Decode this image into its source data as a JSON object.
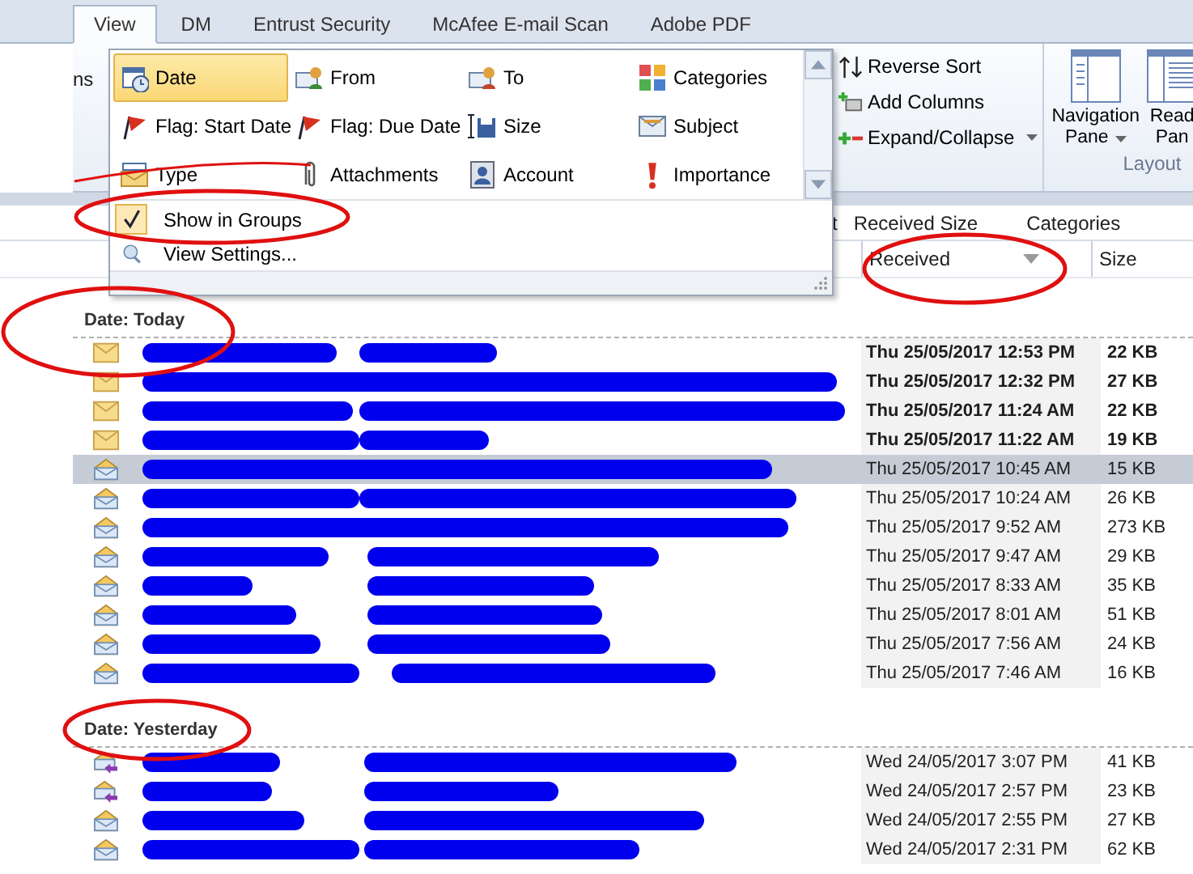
{
  "tabs": [
    {
      "label": "View",
      "selected": true
    },
    {
      "label": "DM",
      "selected": false
    },
    {
      "label": "Entrust Security",
      "selected": false
    },
    {
      "label": "McAfee E-mail Scan",
      "selected": false
    },
    {
      "label": "Adobe PDF",
      "selected": false
    }
  ],
  "ribbon": {
    "left_fragment": "ns",
    "sort_buttons": [
      {
        "label": "Reverse Sort",
        "dropdown": false
      },
      {
        "label": "Add Columns",
        "dropdown": false
      },
      {
        "label": "Expand/Collapse",
        "dropdown": true
      }
    ],
    "layout_buttons": [
      {
        "lines": [
          "Navigation",
          "Pane"
        ],
        "dropdown": true
      },
      {
        "lines": [
          "Read",
          "Pan"
        ],
        "dropdown": false
      }
    ],
    "layout_group_label": "Layout"
  },
  "arrange_menu": {
    "items": [
      {
        "label": "Date",
        "selected": true
      },
      {
        "label": "From",
        "selected": false
      },
      {
        "label": "To",
        "selected": false
      },
      {
        "label": "Categories",
        "selected": false
      },
      {
        "label": "Flag: Start Date",
        "selected": false
      },
      {
        "label": "Flag: Due Date",
        "selected": false
      },
      {
        "label": "Size",
        "selected": false
      },
      {
        "label": "Subject",
        "selected": false
      },
      {
        "label": "Type",
        "selected": false
      },
      {
        "label": "Attachments",
        "selected": false
      },
      {
        "label": "Account",
        "selected": false
      },
      {
        "label": "Importance",
        "selected": false
      }
    ],
    "options": [
      {
        "label": "Show in Groups",
        "checked": true
      },
      {
        "label": "View Settings...",
        "checked": false
      }
    ]
  },
  "column_tray": {
    "fragment": "t",
    "fields": [
      "Received Size",
      "Categories"
    ]
  },
  "columns": [
    {
      "label": "Received",
      "sorted": true
    },
    {
      "label": "Size",
      "sorted": false
    }
  ],
  "groups": [
    {
      "label": "Date: Today",
      "rows": [
        {
          "kind": "unread",
          "unread": true,
          "selected": false,
          "received": "Thu 25/05/2017 12:53 PM",
          "size": "22 KB"
        },
        {
          "kind": "unread",
          "unread": true,
          "selected": false,
          "received": "Thu 25/05/2017 12:32 PM",
          "size": "27 KB"
        },
        {
          "kind": "unread",
          "unread": true,
          "selected": false,
          "received": "Thu 25/05/2017 11:24 AM",
          "size": "22 KB"
        },
        {
          "kind": "unread",
          "unread": true,
          "selected": false,
          "received": "Thu 25/05/2017 11:22 AM",
          "size": "19 KB"
        },
        {
          "kind": "read",
          "unread": false,
          "selected": true,
          "received": "Thu 25/05/2017 10:45 AM",
          "size": "15 KB"
        },
        {
          "kind": "read",
          "unread": false,
          "selected": false,
          "received": "Thu 25/05/2017 10:24 AM",
          "size": "26 KB"
        },
        {
          "kind": "read",
          "unread": false,
          "selected": false,
          "received": "Thu 25/05/2017 9:52 AM",
          "size": "273 KB"
        },
        {
          "kind": "read",
          "unread": false,
          "selected": false,
          "received": "Thu 25/05/2017 9:47 AM",
          "size": "29 KB"
        },
        {
          "kind": "read",
          "unread": false,
          "selected": false,
          "received": "Thu 25/05/2017 8:33 AM",
          "size": "35 KB"
        },
        {
          "kind": "read",
          "unread": false,
          "selected": false,
          "received": "Thu 25/05/2017 8:01 AM",
          "size": "51 KB"
        },
        {
          "kind": "read",
          "unread": false,
          "selected": false,
          "received": "Thu 25/05/2017 7:56 AM",
          "size": "24 KB"
        },
        {
          "kind": "read",
          "unread": false,
          "selected": false,
          "received": "Thu 25/05/2017 7:46 AM",
          "size": "16 KB"
        }
      ]
    },
    {
      "label": "Date: Yesterday",
      "rows": [
        {
          "kind": "replied",
          "unread": false,
          "selected": false,
          "received": "Wed 24/05/2017 3:07 PM",
          "size": "41 KB"
        },
        {
          "kind": "replied",
          "unread": false,
          "selected": false,
          "received": "Wed 24/05/2017 2:57 PM",
          "size": "23 KB"
        },
        {
          "kind": "read",
          "unread": false,
          "selected": false,
          "received": "Wed 24/05/2017 2:55 PM",
          "size": "27 KB"
        },
        {
          "kind": "read",
          "unread": false,
          "selected": false,
          "received": "Wed 24/05/2017 2:31 PM",
          "size": "62 KB"
        }
      ]
    }
  ]
}
